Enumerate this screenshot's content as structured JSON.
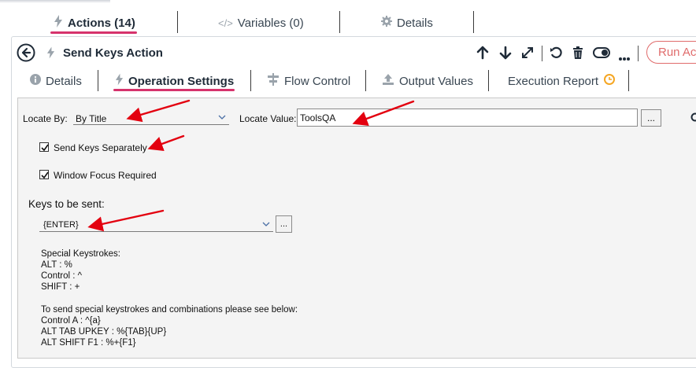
{
  "top_tabs": [
    {
      "label": "Actions (14)",
      "icon": "lightning-icon"
    },
    {
      "label": "Variables (0)",
      "icon": "code-icon"
    },
    {
      "label": "Details",
      "icon": "gear-icon"
    }
  ],
  "action_header": {
    "title": "Send Keys Action",
    "run_label": "Run Act"
  },
  "sub_tabs": [
    {
      "label": "Details",
      "icon": "info-icon"
    },
    {
      "label": "Operation Settings",
      "icon": "lightning-icon"
    },
    {
      "label": "Flow Control",
      "icon": "flow-icon"
    },
    {
      "label": "Output Values",
      "icon": "upload-icon"
    },
    {
      "label": "Execution Report",
      "icon": "clock-icon"
    }
  ],
  "form": {
    "locate_by_label": "Locate By:",
    "locate_by_value": "By Title",
    "locate_value_label": "Locate Value:",
    "locate_value_value": "ToolsQA",
    "browse_label": "...",
    "send_keys_separately_label": "Send Keys Separately",
    "send_keys_separately_checked": true,
    "window_focus_label": "Window Focus Required",
    "window_focus_checked": true,
    "keys_label": "Keys to be sent:",
    "keys_value": "{ENTER}",
    "keys_browse_label": "..."
  },
  "notes": {
    "special_title": "Special Keystrokes:",
    "alt": "ALT : %",
    "control": "Control : ^",
    "shift": "SHIFT : +",
    "combo_title": "To send special keystrokes and combinations please see below:",
    "control_a": "Control A : ^{a}",
    "alt_tab": "ALT TAB UPKEY : %{TAB}{UP}",
    "alt_shift": "ALT SHIFT F1 : %+{F1}"
  },
  "colors": {
    "accent_underline": "#d6336c",
    "run_border": "#e06c6c",
    "annotation_arrow": "#e3000f",
    "clock_icon": "#f5a623"
  }
}
